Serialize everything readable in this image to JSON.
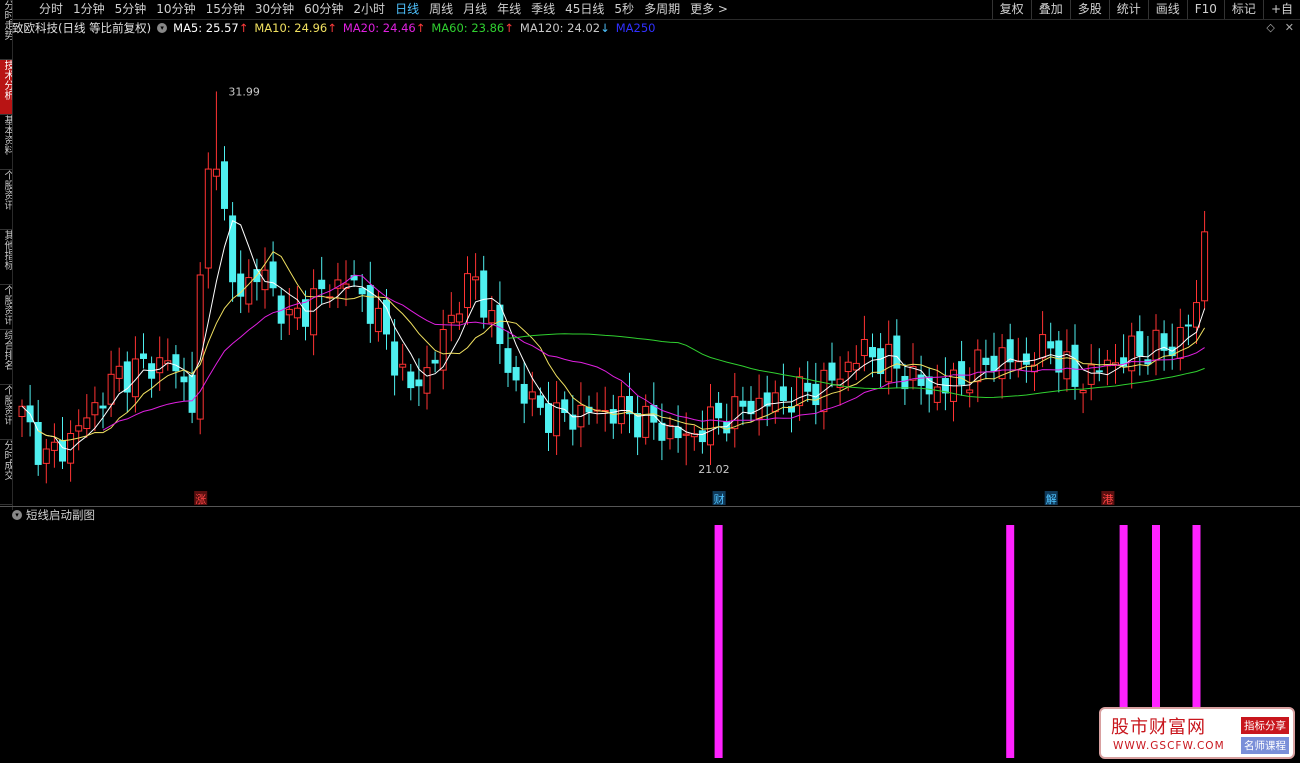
{
  "toolbar": {
    "periods": [
      "分时",
      "1分钟",
      "5分钟",
      "10分钟",
      "15分钟",
      "30分钟",
      "60分钟",
      "2小时",
      "日线",
      "周线",
      "月线",
      "年线",
      "季线",
      "45日线",
      "5秒",
      "多周期",
      "更多 >"
    ],
    "active_period": "日线",
    "tools": [
      "复权",
      "叠加",
      "多股",
      "统计",
      "画线",
      "F10",
      "标记",
      "+自"
    ]
  },
  "sidebar": {
    "tabs": [
      "分时走势",
      "技术分析",
      "基本资料",
      "个股资讯",
      "其他指标",
      "个股资讯",
      "综合排名",
      "个股资讯",
      "分时成交"
    ],
    "active_index": 1
  },
  "chart_header": {
    "stock_title": "致欧科技(日线 等比前复权)",
    "ma": [
      {
        "label": "MA5: 25.57",
        "color": "#ffffff",
        "arrow": "↑",
        "arrow_color": "#ff3b3b"
      },
      {
        "label": "MA10: 24.96",
        "color": "#f0e060",
        "arrow": "↑",
        "arrow_color": "#ff3b3b"
      },
      {
        "label": "MA20: 24.46",
        "color": "#e020e0",
        "arrow": "↑",
        "arrow_color": "#ff3b3b"
      },
      {
        "label": "MA60: 23.86",
        "color": "#30d030",
        "arrow": "↑",
        "arrow_color": "#ff3b3b"
      },
      {
        "label": "MA120: 24.02",
        "color": "#c8c8c8",
        "arrow": "↓",
        "arrow_color": "#4fc3ff"
      },
      {
        "label": "MA250",
        "color": "#3030ff",
        "arrow": "",
        "arrow_color": "#3030ff"
      }
    ]
  },
  "chart_data": {
    "type": "candlestick",
    "price_range": [
      20.0,
      33.5
    ],
    "high_label": "31.99",
    "low_label": "21.02",
    "up_color": "#ff3333",
    "down_color": "#4ff0f0",
    "event_markers": [
      {
        "text": "涨",
        "index": 22,
        "color": "#ff4444"
      },
      {
        "text": "财",
        "index": 86,
        "color": "#4fc3ff"
      },
      {
        "text": "解",
        "index": 127,
        "color": "#4fc3ff"
      },
      {
        "text": "港",
        "index": 134,
        "color": "#ff4444"
      }
    ]
  },
  "sub_chart": {
    "title": "短线启动副图",
    "bar_color": "#ff22ff",
    "signal_indices": [
      86,
      122,
      136,
      140,
      145
    ]
  },
  "watermark": {
    "title": "股市财富网",
    "url": "WWW.GSCFW.COM",
    "tag1": "指标分享",
    "tag2": "名师课程"
  }
}
